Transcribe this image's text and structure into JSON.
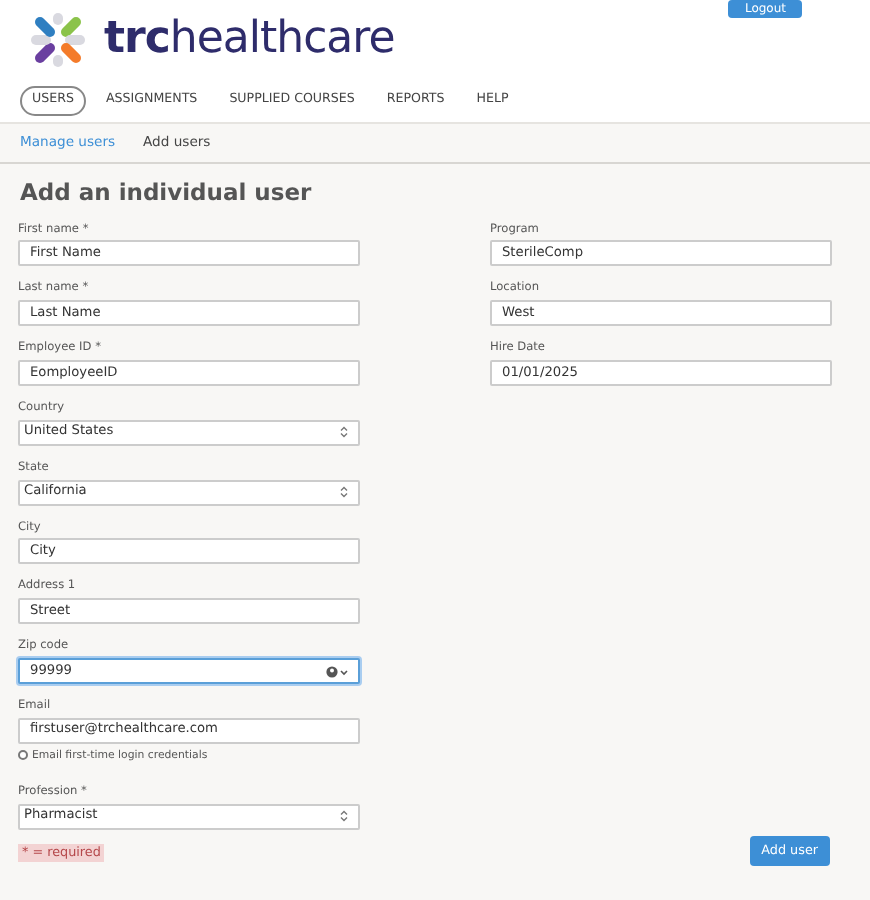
{
  "header": {
    "logo_text": "**trc**healthcare",
    "logout_button": "Logout"
  },
  "nav": [
    {
      "label": "USERS",
      "selected": true
    },
    {
      "label": "ASSIGNMENTS",
      "selected": false
    },
    {
      "label": "SUPPLIED COURSES",
      "selected": false
    },
    {
      "label": "REPORTS",
      "selected": false
    },
    {
      "label": "HELP",
      "selected": false
    }
  ],
  "subnav": [
    {
      "label": "Manage users",
      "selected": true
    },
    {
      "label": "Add users",
      "selected": false
    }
  ],
  "form": {
    "title": "Add an individual user",
    "left_fields": [
      {
        "label": "First name *",
        "kind": "text",
        "value": "First Name",
        "focused": false
      },
      {
        "label": "Last name *",
        "kind": "text",
        "value": "Last Name",
        "focused": false
      },
      {
        "label": "Employee ID *",
        "kind": "text",
        "value": "EomployeeID",
        "focused": false
      },
      {
        "label": "Country",
        "kind": "select",
        "value": "United States",
        "focused": false
      },
      {
        "label": "State",
        "kind": "select",
        "value": "California",
        "focused": false
      },
      {
        "label": "City",
        "kind": "text",
        "value": "City",
        "focused": false
      },
      {
        "label": "Address 1",
        "kind": "text",
        "value": "Street",
        "focused": false
      },
      {
        "label": "Zip code",
        "kind": "autofill",
        "value": "99999",
        "focused": true
      },
      {
        "label": "Email",
        "kind": "text",
        "value": "firstuser@trchealthcare.com",
        "focused": false
      },
      {
        "label": "Email first-time login credentials",
        "kind": "checkbox",
        "checked": false
      },
      {
        "label": "Profession *",
        "kind": "select",
        "value": "Pharmacist",
        "focused": false
      }
    ],
    "right_fields": [
      {
        "label": "Program",
        "kind": "text",
        "value": "SterileComp",
        "focused": false
      },
      {
        "label": "Location",
        "kind": "text",
        "value": "West",
        "focused": false
      },
      {
        "label": "Hire Date",
        "kind": "text",
        "value": "01/01/2025",
        "focused": false
      }
    ],
    "required_note": "* = required",
    "submit_button": "Add user"
  }
}
